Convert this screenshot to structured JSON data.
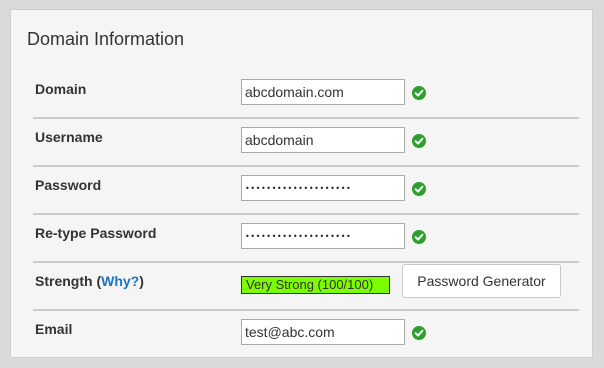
{
  "section": {
    "title": "Domain Information"
  },
  "fields": {
    "domain": {
      "label": "Domain",
      "value": "abcdomain.com"
    },
    "username": {
      "label": "Username",
      "value": "abcdomain"
    },
    "password": {
      "label": "Password",
      "value": "••••••••••••••••••••"
    },
    "retype": {
      "label": "Re-type Password",
      "value": "••••••••••••••••••••"
    },
    "email": {
      "label": "Email",
      "value": "test@abc.com"
    }
  },
  "strength": {
    "label": "Strength",
    "open_paren": " (",
    "why_link": "Why?",
    "close_paren": ")",
    "meter_text": "Very Strong (100/100)",
    "meter_color": "#7cfc00"
  },
  "generator": {
    "label": "Password Generator"
  },
  "icons": {
    "valid": "check-circle-icon",
    "valid_color": "#2e9e2e"
  }
}
